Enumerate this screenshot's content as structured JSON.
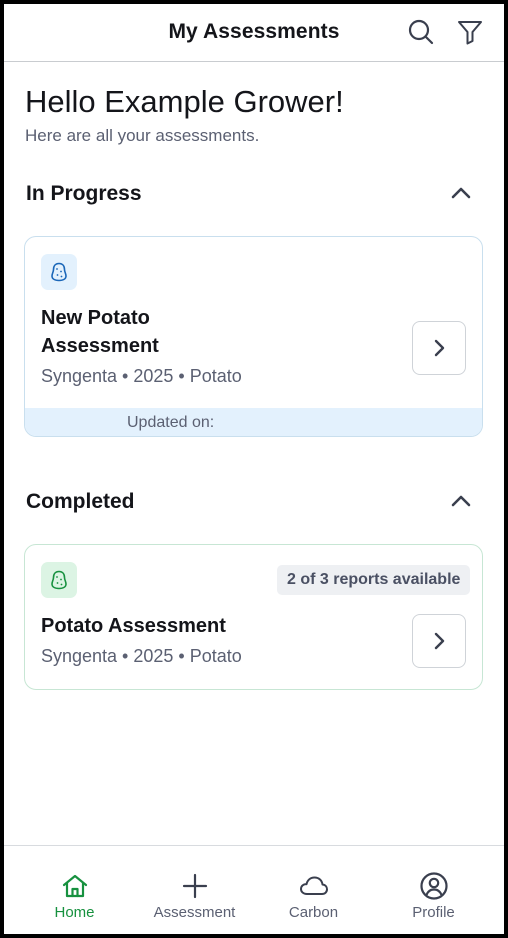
{
  "header": {
    "title": "My Assessments",
    "search_icon": "search-icon",
    "filter_icon": "filter-icon"
  },
  "greeting": {
    "title": "Hello Example Grower!",
    "subtitle": "Here are all your assessments."
  },
  "sections": {
    "in_progress": {
      "title": "In Progress",
      "expanded": true,
      "cards": [
        {
          "title_line1": "New Potato",
          "title_line2": "Assessment",
          "meta": "Syngenta • 2025 • Potato",
          "updated_label": "Updated on:",
          "icon": "potato-icon"
        }
      ]
    },
    "completed": {
      "title": "Completed",
      "expanded": true,
      "cards": [
        {
          "title": "Potato Assessment",
          "meta": "Syngenta • 2025 • Potato",
          "reports_badge": "2 of 3 reports available",
          "icon": "potato-icon"
        }
      ]
    }
  },
  "bottom_nav": {
    "items": [
      {
        "label": "Home",
        "icon": "home-icon",
        "active": true
      },
      {
        "label": "Assessment",
        "icon": "plus-icon",
        "active": false
      },
      {
        "label": "Carbon",
        "icon": "cloud-icon",
        "active": false
      },
      {
        "label": "Profile",
        "icon": "profile-icon",
        "active": false
      }
    ]
  },
  "colors": {
    "accent_green": "#17913f",
    "in_progress_tint": "#e3f1fd",
    "completed_tint": "#dcf4e4",
    "text_primary": "#14151a",
    "text_secondary": "#5b6072"
  }
}
